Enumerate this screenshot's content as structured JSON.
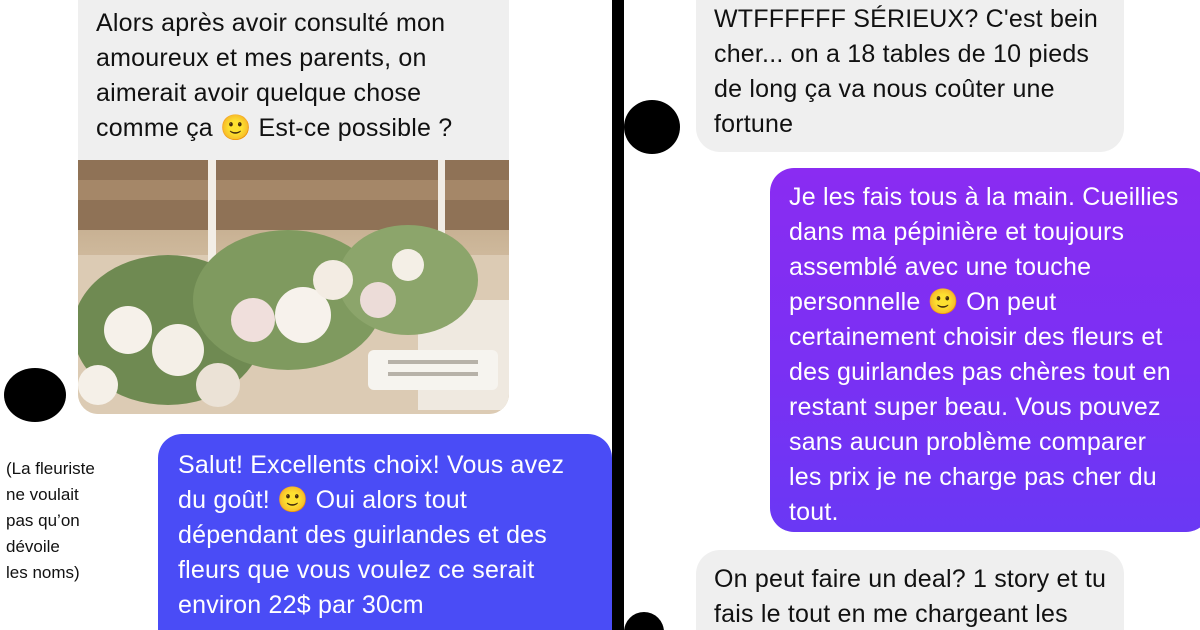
{
  "left_chat": {
    "received_message": "Alors après avoir consulté mon\namoureux et mes parents, on\naimerait avoir quelque chose\ncomme ça 🙂 Est-ce possible ?",
    "photo_icon": "floral-table-arrangement-photo",
    "caption": "(La fleuriste\nne voulait\npas qu’on\ndévoile\nles noms)",
    "sent_message": "Salut! Excellents choix! Vous avez\ndu goût! 🙂 Oui alors tout\ndépendant des guirlandes et des\nfleurs que vous voulez ce serait\nenviron 22$ par 30cm"
  },
  "right_chat": {
    "received_message_1": "WTFFFFFF SÉRIEUX? C'est bein\ncher... on a 18 tables de 10 pieds\nde long ça va nous coûter une\nfortune",
    "sent_message": "Je les fais tous à la main. Cueillies\ndans ma pépinière et toujours\nassemblé avec une touche\npersonnelle 🙂 On peut\ncertainement choisir des fleurs et\ndes guirlandes pas chères tout en\nrestant super beau. Vous pouvez\nsans aucun problème comparer\nles prix je ne charge pas cher du\ntout.",
    "received_message_2": "On peut faire un deal? 1 story et tu\nfais le tout en me chargeant les"
  },
  "colors": {
    "received_bubble": "#efefef",
    "sent_bubble_blue": "#4a4cf6",
    "sent_bubble_purple": "#7a30f3",
    "redaction": "#000000"
  }
}
